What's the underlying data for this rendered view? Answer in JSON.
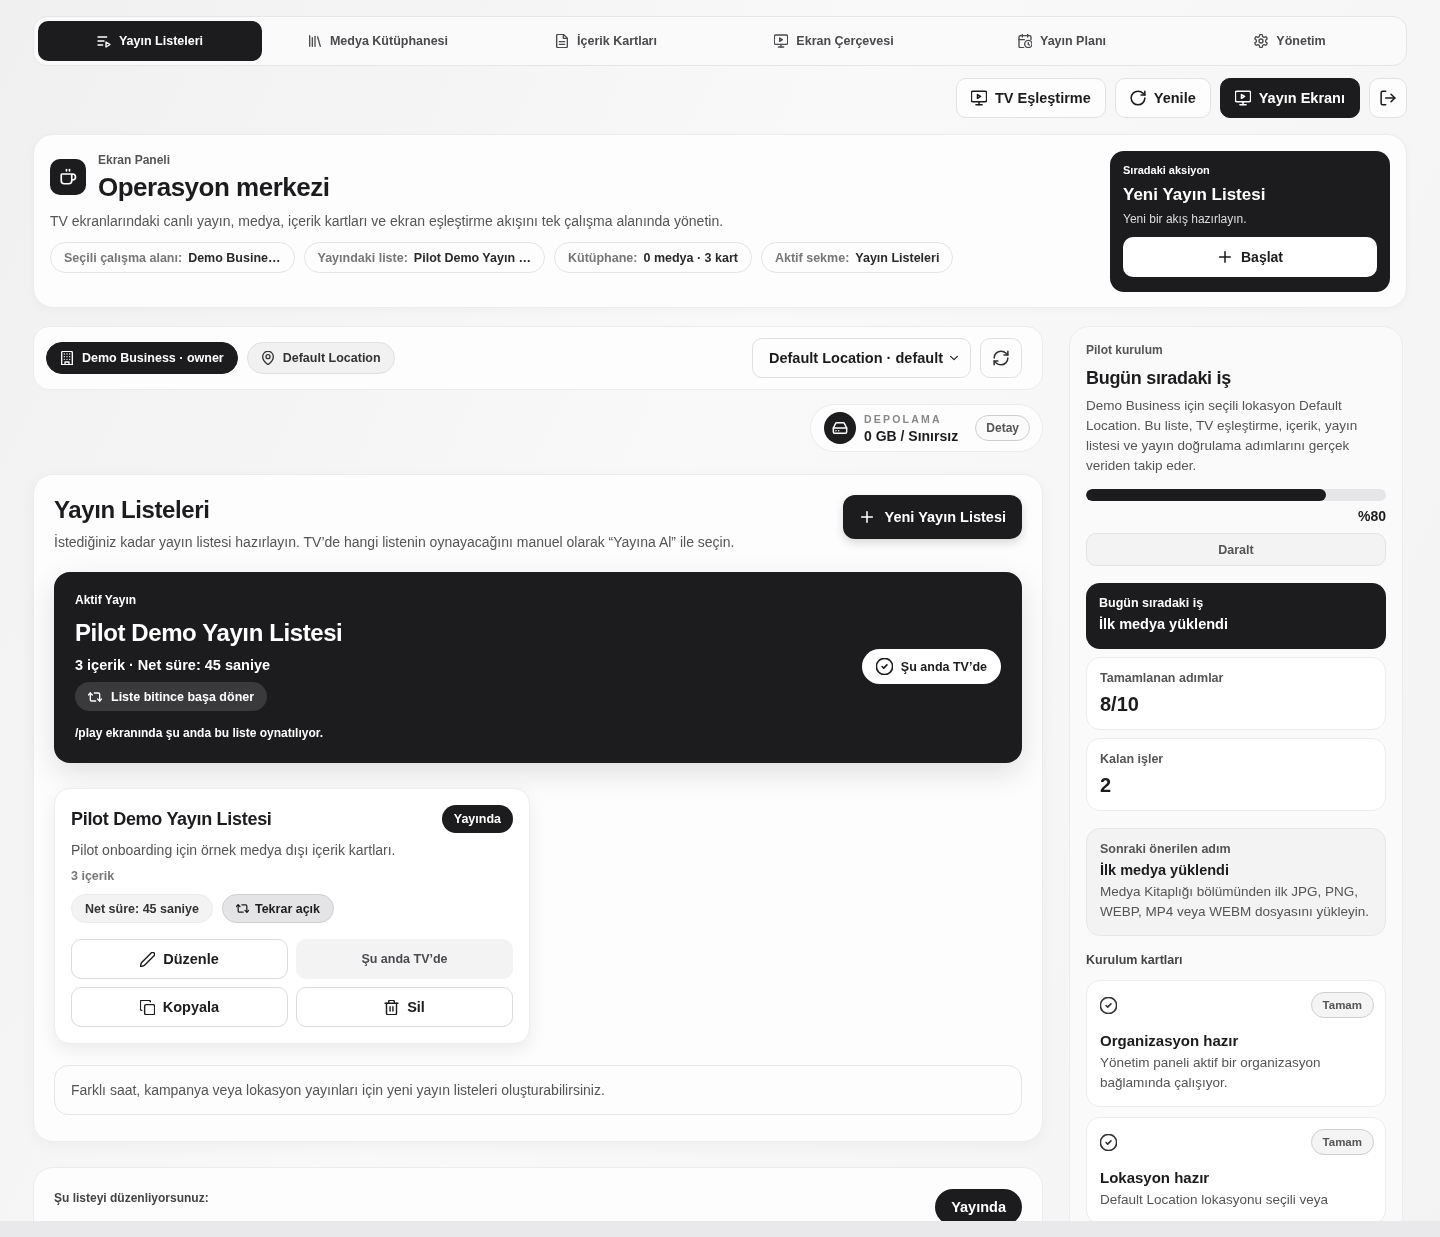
{
  "nav": {
    "tabs": [
      {
        "label": "Yayın Listeleri",
        "selected": true
      },
      {
        "label": "Medya Kütüphanesi",
        "selected": false
      },
      {
        "label": "İçerik Kartları",
        "selected": false
      },
      {
        "label": "Ekran Çerçevesi",
        "selected": false
      },
      {
        "label": "Yayın Planı",
        "selected": false
      },
      {
        "label": "Yönetim",
        "selected": false
      }
    ]
  },
  "toolbar": {
    "buttons": [
      {
        "label": "TV Eşleştirme",
        "kind": "pair"
      },
      {
        "label": "Yenile",
        "kind": "refresh"
      },
      {
        "label": "Yayın Ekranı",
        "kind": "screen"
      }
    ]
  },
  "header": {
    "eyebrow": "Ekran Paneli",
    "title": "Operasyon merkezi",
    "description": "TV ekranlarındaki canlı yayın, medya, içerik kartları ve ekran eşleştirme akışını tek çalışma alanında yönetin.",
    "chips": [
      {
        "label": "Seçili çalışma alanı:",
        "value": "Demo Busine…"
      },
      {
        "label": "Yayındaki liste:",
        "value": "Pilot Demo Yayın …"
      },
      {
        "label": "Kütüphane:",
        "value": "0 medya · 3 kart"
      },
      {
        "label": "Aktif sekme:",
        "value": "Yayın Listeleri"
      }
    ]
  },
  "next_action": {
    "eyebrow": "Sıradaki aksiyon",
    "title": "Yeni Yayın Listesi",
    "description": "Yeni bir akış hazırlayın.",
    "button": "Başlat"
  },
  "context_bar": {
    "chips": [
      {
        "label": "Demo Business · owner",
        "kind": "business"
      },
      {
        "label": "Default Location",
        "kind": "location"
      }
    ],
    "location_select": {
      "value": "Default Location · default"
    }
  },
  "storage": {
    "label": "DEPOLAMA",
    "value": "0 GB / Sınırsız",
    "button": "Detay"
  },
  "playlists": {
    "title": "Yayın Listeleri",
    "description": "İstediğiniz kadar yayın listesi hazırlayın. TV’de hangi listenin oynayacağını manuel olarak “Yayına Al” ile seçin.",
    "new_button": "Yeni Yayın Listesi",
    "active": {
      "eyebrow": "Aktif Yayın",
      "title": "Pilot Demo Yayın Listesi",
      "meta": "3 içerik · Net süre: 45 saniye",
      "loop_chip": "Liste bitince başa döner",
      "note": "/play ekranında şu anda bu liste oynatılıyor.",
      "status_button": "Şu anda TV’de"
    },
    "cards": [
      {
        "title": "Pilot Demo Yayın Listesi",
        "badge": "Yayında",
        "description": "Pilot onboarding için örnek medya dışı içerik kartları.",
        "count": "3 içerik",
        "chips": [
          {
            "label": "Net süre: 45 saniye",
            "kind": "plain"
          },
          {
            "label": "Tekrar açık",
            "kind": "repeat"
          }
        ],
        "actions": [
          {
            "label": "Düzenle",
            "kind": "edit",
            "disabled": false
          },
          {
            "label": "Şu anda TV’de",
            "kind": "live",
            "disabled": true
          },
          {
            "label": "Kopyala",
            "kind": "copy",
            "disabled": false
          },
          {
            "label": "Sil",
            "kind": "delete",
            "disabled": false
          }
        ]
      }
    ],
    "hint": "Farklı saat, kampanya veya lokasyon yayınları için yeni yayın listeleri oluşturabilirsiniz."
  },
  "editor": {
    "eyebrow": "Şu listeyi düzenliyorsunuz:",
    "status": "Yayında"
  },
  "sidebar": {
    "eyebrow": "Pilot kurulum",
    "title": "Bugün sıradaki iş",
    "description": "Demo Business için seçili lokasyon Default Location. Bu liste, TV eşleştirme, içerik, yayın listesi ve yayın doğrulama adımlarını gerçek veriden takip eder.",
    "progress": {
      "level": 0.8,
      "reading": "%80"
    },
    "collapse_button": "Daralt",
    "today": {
      "label": "Bugün sıradaki iş",
      "title": "İlk medya yüklendi"
    },
    "stats": [
      {
        "label": "Tamamlanan adımlar",
        "value": "8/10"
      },
      {
        "label": "Kalan işler",
        "value": "2"
      }
    ],
    "suggestion": {
      "label": "Sonraki önerilen adım",
      "title": "İlk medya yüklendi",
      "description": "Medya Kitaplığı bölümünden ilk JPG, PNG, WEBP, MP4 veya WEBM dosyasını yükleyin."
    },
    "setup_heading": "Kurulum kartları",
    "setup_cards": [
      {
        "done": true,
        "badge": "Tamam",
        "title": "Organizasyon hazır",
        "description": "Yönetim paneli aktif bir organizasyon bağlamında çalışıyor."
      },
      {
        "done": true,
        "badge": "Tamam",
        "title": "Lokasyon hazır",
        "description": "Default Location lokasyonu seçili veya"
      }
    ]
  }
}
